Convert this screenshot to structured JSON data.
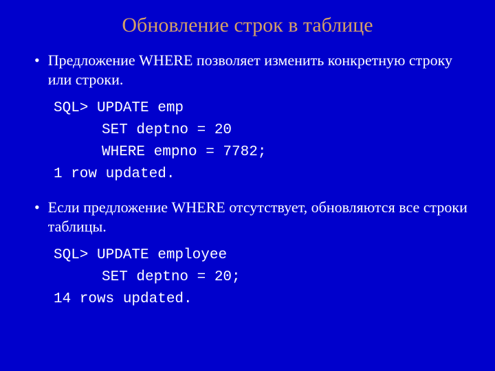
{
  "title": "Обновление строк в таблице",
  "bullets": [
    {
      "text": "Предложение WHERE позволяет изменить конкретную строку или строки.",
      "code": [
        {
          "text": "SQL> UPDATE emp",
          "indent": false
        },
        {
          "text": "SET deptno = 20",
          "indent": true
        },
        {
          "text": "WHERE empno = 7782;",
          "indent": true
        },
        {
          "text": "1 row updated.",
          "indent": false
        }
      ]
    },
    {
      "text": "Если предложение WHERE отсутствует, обновляются все строки таблицы.",
      "code": [
        {
          "text": "SQL> UPDATE employee",
          "indent": false
        },
        {
          "text": "SET deptno = 20;",
          "indent": true
        },
        {
          "text": "14 rows updated.",
          "indent": false
        }
      ]
    }
  ]
}
